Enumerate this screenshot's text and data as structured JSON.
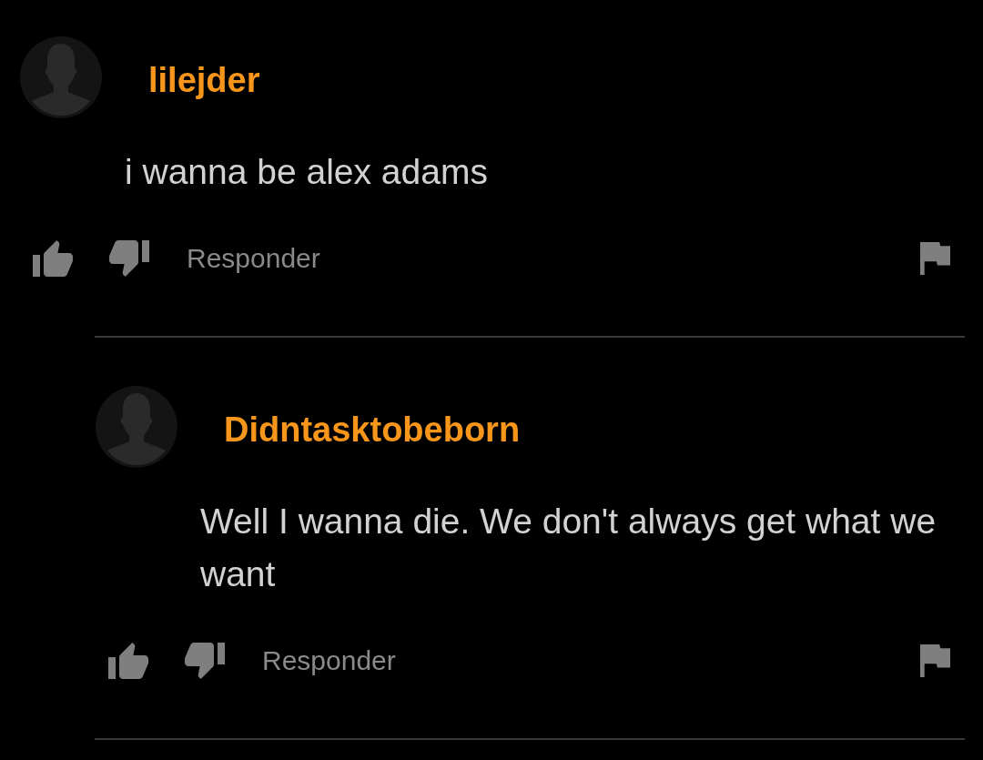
{
  "comments": [
    {
      "author": "lilejder",
      "text": "i wanna be alex adams",
      "reply_label": "Responder",
      "children": [
        {
          "author": "Didntasktobeborn",
          "text": "Well I wanna die. We don't always get what we want",
          "reply_label": "Responder"
        }
      ]
    }
  ]
}
